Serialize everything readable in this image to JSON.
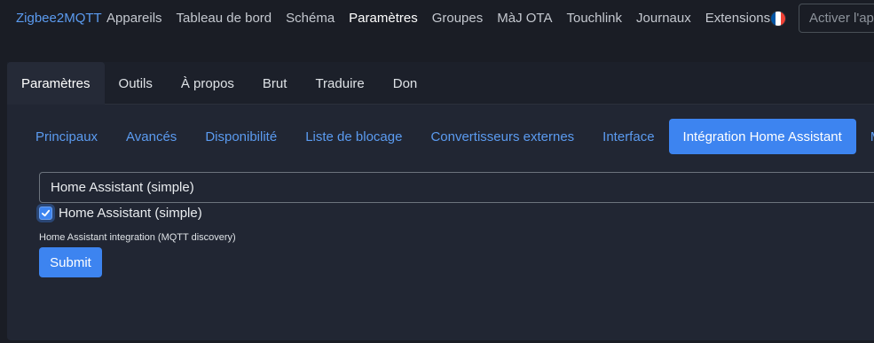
{
  "navbar": {
    "brand": "Zigbee2MQTT",
    "links": [
      {
        "label": "Appareils",
        "active": false
      },
      {
        "label": "Tableau de bord",
        "active": false
      },
      {
        "label": "Schéma",
        "active": false
      },
      {
        "label": "Paramètres",
        "active": true
      },
      {
        "label": "Groupes",
        "active": false
      },
      {
        "label": "MàJ OTA",
        "active": false
      },
      {
        "label": "Touchlink",
        "active": false
      },
      {
        "label": "Journaux",
        "active": false
      },
      {
        "label": "Extensions",
        "active": false
      }
    ],
    "language_flag": "french-flag-icon",
    "flag_colors": [
      "#0055a4",
      "#ffffff",
      "#ef4135"
    ],
    "search_value": "Activer l'ap"
  },
  "main_tabs": [
    {
      "label": "Paramètres",
      "active": true
    },
    {
      "label": "Outils",
      "active": false
    },
    {
      "label": "À propos",
      "active": false
    },
    {
      "label": "Brut",
      "active": false
    },
    {
      "label": "Traduire",
      "active": false
    },
    {
      "label": "Don",
      "active": false
    }
  ],
  "sub_tabs": [
    {
      "label": "Principaux",
      "active": false
    },
    {
      "label": "Avancés",
      "active": false
    },
    {
      "label": "Disponibilité",
      "active": false
    },
    {
      "label": "Liste de blocage",
      "active": false
    },
    {
      "label": "Convertisseurs externes",
      "active": false
    },
    {
      "label": "Interface",
      "active": false
    },
    {
      "label": "Intégration Home Assistant",
      "active": true
    },
    {
      "label": "MQ",
      "active": false
    }
  ],
  "form": {
    "select_value": "Home Assistant (simple)",
    "checkbox_label": "Home Assistant (simple)",
    "checkbox_checked": true,
    "help_text": "Home Assistant integration (MQTT discovery)",
    "submit_label": "Submit"
  },
  "colors": {
    "accent": "#3d84f0",
    "link": "#5b9bf0",
    "background": "#1a1d25",
    "card": "#212633"
  }
}
